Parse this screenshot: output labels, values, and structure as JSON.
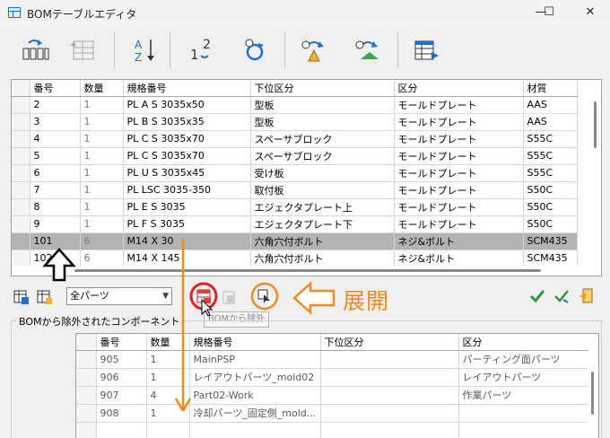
{
  "window": {
    "title": "BOMテーブルエディタ",
    "minimize_glyph": "—",
    "maximize_glyph": "☐",
    "close_glyph": "✕"
  },
  "toolbar": {
    "buttons": [
      {
        "name": "expand-tree-icon"
      },
      {
        "name": "collapse-tree-icon"
      },
      {
        "name": "sort-az-icon"
      },
      {
        "name": "renumber-icon"
      },
      {
        "name": "refresh-numbers-icon"
      },
      {
        "name": "replace-part-a-icon"
      },
      {
        "name": "replace-part-b-icon"
      },
      {
        "name": "export-table-icon"
      }
    ]
  },
  "bom_table": {
    "columns": [
      "番号",
      "数量",
      "規格番号",
      "下位区分",
      "区分",
      "材質"
    ],
    "rows": [
      {
        "no": "2",
        "qty": "1",
        "spec": "PL A S 3035x50",
        "sub": "型板",
        "cat": "モールドプレート",
        "mat": "AAS"
      },
      {
        "no": "3",
        "qty": "1",
        "spec": "PL B S 3035x35",
        "sub": "型板",
        "cat": "モールドプレート",
        "mat": "AAS"
      },
      {
        "no": "4",
        "qty": "1",
        "spec": "PL C S 3035x70",
        "sub": "スペーサブロック",
        "cat": "モールドプレート",
        "mat": "S55C"
      },
      {
        "no": "5",
        "qty": "1",
        "spec": "PL C S 3035x70",
        "sub": "スペーサブロック",
        "cat": "モールドプレート",
        "mat": "S55C"
      },
      {
        "no": "6",
        "qty": "1",
        "spec": "PL U S 3035x45",
        "sub": "受け板",
        "cat": "モールドプレート",
        "mat": "S55C"
      },
      {
        "no": "7",
        "qty": "1",
        "spec": "PL LSC 3035-350",
        "sub": "取付板",
        "cat": "モールドプレート",
        "mat": "S50C"
      },
      {
        "no": "8",
        "qty": "1",
        "spec": "PL E S 3035",
        "sub": "エジェクタプレート上",
        "cat": "モールドプレート",
        "mat": "S50C"
      },
      {
        "no": "9",
        "qty": "1",
        "spec": "PL F S 3035",
        "sub": "エジェクタプレート下",
        "cat": "モールドプレート",
        "mat": "S50C"
      },
      {
        "no": "101",
        "qty": "6",
        "spec": "M14 X 30",
        "sub": "六角穴付ボルト",
        "cat": "ネジ&ボルト",
        "mat": "SCM435"
      },
      {
        "no": "102",
        "qty": "6",
        "spec": "M14 X 145",
        "sub": "六角穴付ボルト",
        "cat": "ネジ&ボルト",
        "mat": "SCM435"
      }
    ],
    "selected_row": 8
  },
  "filter": {
    "selected": "全パーツ"
  },
  "annotations": {
    "expand_label": "展開",
    "tooltip": "BOMから除外"
  },
  "excluded": {
    "group_label": "BOMから除外されたコンポーネント",
    "columns": [
      "番号",
      "数量",
      "規格番号",
      "下位区分",
      "区分"
    ],
    "rows": [
      {
        "no": "905",
        "qty": "1",
        "spec": "MainPSP",
        "sub": "",
        "cat": "パーティング面パーツ"
      },
      {
        "no": "906",
        "qty": "1",
        "spec": "レイアウトパーツ_mold02",
        "sub": "",
        "cat": "レイアウトパーツ"
      },
      {
        "no": "907",
        "qty": "4",
        "spec": "Part02-Work",
        "sub": "",
        "cat": "作業パーツ"
      },
      {
        "no": "908",
        "qty": "1",
        "spec": "冷却パーツ_固定側_mold...",
        "sub": "",
        "cat": ""
      },
      {
        "no": "",
        "qty": "",
        "spec": "",
        "sub": "",
        "cat": ""
      }
    ]
  },
  "colors": {
    "accent_orange": "#f08a24",
    "highlight_red": "#e02020",
    "check_green": "#2f9a3a",
    "selected_row": "#b3b3b3"
  }
}
